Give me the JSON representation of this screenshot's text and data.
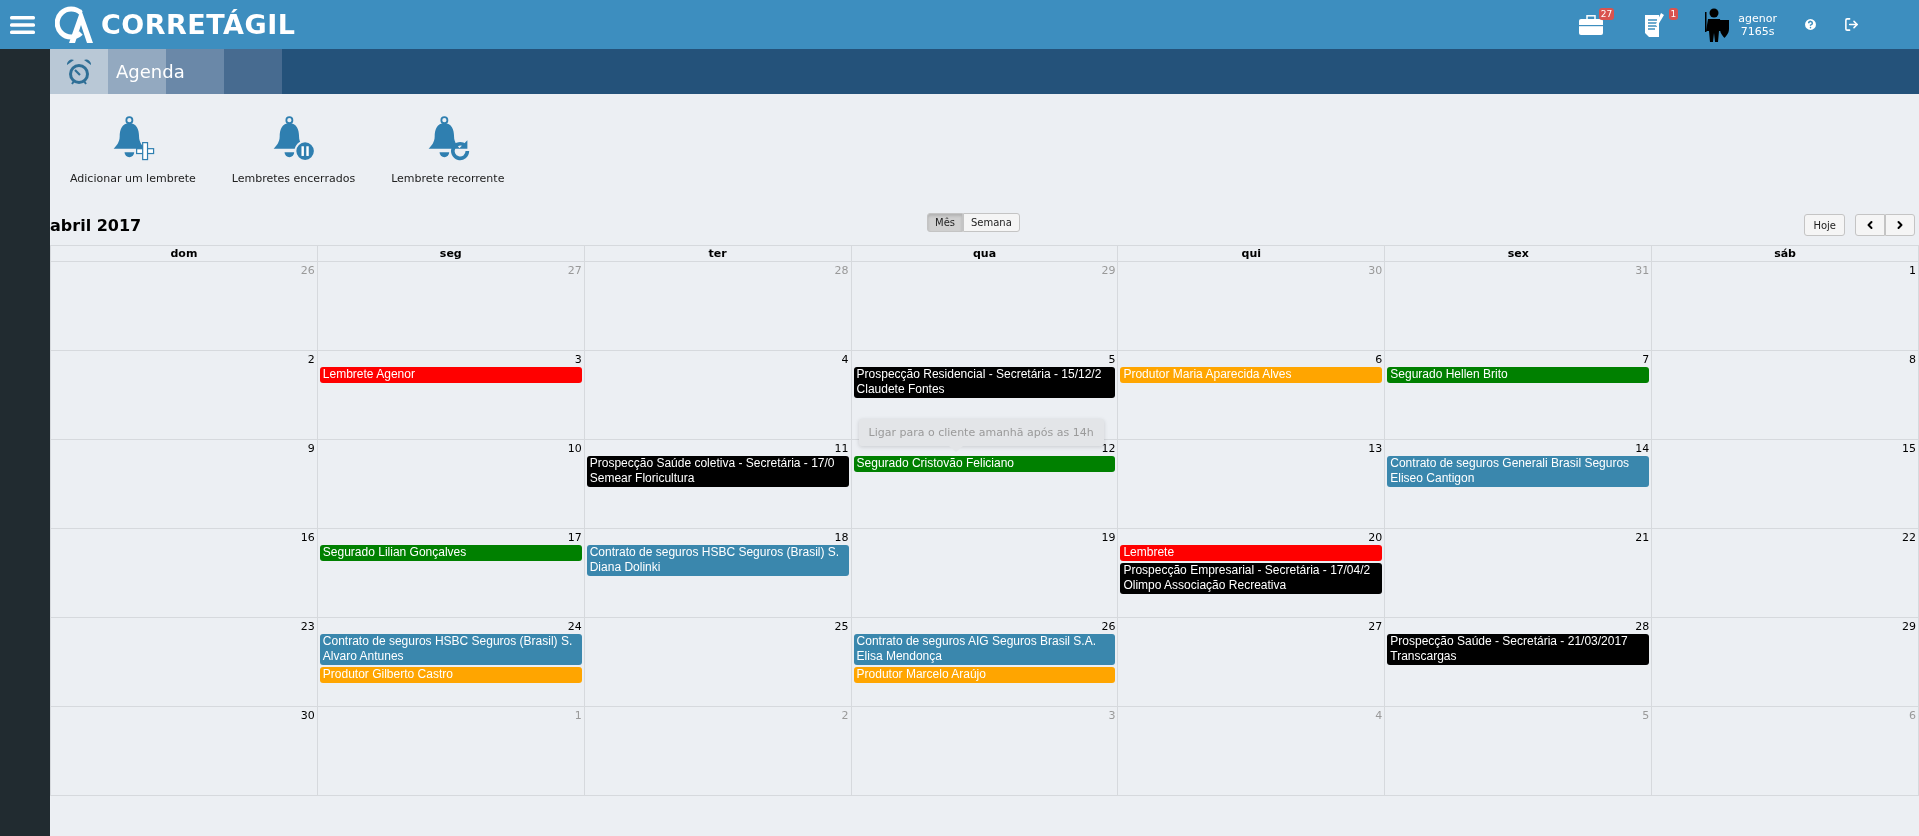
{
  "topbar": {
    "brand": "CORRETÁGIL",
    "notifications": [
      {
        "kind": "briefcase",
        "count": "27"
      },
      {
        "kind": "document",
        "count": "1"
      }
    ],
    "user": {
      "name": "agenor",
      "points": "7165s"
    }
  },
  "nav": {
    "title": "Agenda"
  },
  "actions": [
    {
      "kind": "add",
      "label": "Adicionar um lembrete"
    },
    {
      "kind": "pause",
      "label": "Lembretes encerrados"
    },
    {
      "kind": "recurring",
      "label": "Lembrete recorrente"
    }
  ],
  "calendar": {
    "title": "abril 2017",
    "views": [
      {
        "label": "Mês",
        "selected": true
      },
      {
        "label": "Semana",
        "selected": false
      }
    ],
    "today": "Hoje",
    "weekdays": [
      "dom",
      "seg",
      "ter",
      "qua",
      "qui",
      "sex",
      "sáb"
    ],
    "weeks": [
      {
        "days": [
          {
            "number": "26",
            "other_month": true
          },
          {
            "number": "27",
            "other_month": true
          },
          {
            "number": "28",
            "other_month": true
          },
          {
            "number": "29",
            "other_month": true
          },
          {
            "number": "30",
            "other_month": true
          },
          {
            "number": "31",
            "other_month": true
          },
          {
            "number": "1",
            "other_month": false
          }
        ]
      },
      {
        "days": [
          {
            "number": "2",
            "other_month": false
          },
          {
            "number": "3",
            "other_month": false,
            "events": [
              {
                "lines": [
                  "Lembrete Agenor"
                ],
                "color": "#ff0000"
              }
            ]
          },
          {
            "number": "4",
            "other_month": false
          },
          {
            "number": "5",
            "other_month": false,
            "events": [
              {
                "lines": [
                  "Prospecção Residencial - Secretária - 15/12/2",
                  "Claudete Fontes"
                ],
                "color": "#000000"
              }
            ]
          },
          {
            "number": "6",
            "other_month": false,
            "events": [
              {
                "lines": [
                  "Produtor Maria Aparecida Alves"
                ],
                "color": "#ffa500"
              }
            ]
          },
          {
            "number": "7",
            "other_month": false,
            "events": [
              {
                "lines": [
                  "Segurado Hellen Brito"
                ],
                "color": "#008000"
              }
            ]
          },
          {
            "number": "8",
            "other_month": false
          }
        ]
      },
      {
        "days": [
          {
            "number": "9",
            "other_month": false
          },
          {
            "number": "10",
            "other_month": false
          },
          {
            "number": "11",
            "other_month": false,
            "events": [
              {
                "lines": [
                  "Prospecção Saúde coletiva - Secretária - 17/0",
                  "Semear Floricultura"
                ],
                "color": "#000000"
              }
            ]
          },
          {
            "number": "12",
            "other_month": false,
            "events": [
              {
                "lines": [
                  "Segurado Cristovão Feliciano"
                ],
                "color": "#008000",
                "tooltip": "Ligar para o cliente amanhã após as 14h"
              }
            ]
          },
          {
            "number": "13",
            "other_month": false
          },
          {
            "number": "14",
            "other_month": false,
            "events": [
              {
                "lines": [
                  "Contrato de seguros Generali Brasil Seguros",
                  "Eliseo Cantigon"
                ],
                "color": "#3a87ad"
              }
            ]
          },
          {
            "number": "15",
            "other_month": false
          }
        ]
      },
      {
        "days": [
          {
            "number": "16",
            "other_month": false
          },
          {
            "number": "17",
            "other_month": false,
            "events": [
              {
                "lines": [
                  "Segurado Lilian Gonçalves"
                ],
                "color": "#008000"
              }
            ]
          },
          {
            "number": "18",
            "other_month": false,
            "events": [
              {
                "lines": [
                  "Contrato de seguros HSBC Seguros (Brasil) S.",
                  "Diana Dolinki"
                ],
                "color": "#3a87ad"
              }
            ]
          },
          {
            "number": "19",
            "other_month": false
          },
          {
            "number": "20",
            "other_month": false,
            "events": [
              {
                "lines": [
                  "Lembrete"
                ],
                "color": "#ff0000"
              },
              {
                "lines": [
                  "Prospecção Empresarial - Secretária - 17/04/2",
                  "Olimpo Associação Recreativa"
                ],
                "color": "#000000"
              }
            ]
          },
          {
            "number": "21",
            "other_month": false
          },
          {
            "number": "22",
            "other_month": false
          }
        ]
      },
      {
        "days": [
          {
            "number": "23",
            "other_month": false
          },
          {
            "number": "24",
            "other_month": false,
            "events": [
              {
                "lines": [
                  "Contrato de seguros HSBC Seguros (Brasil) S.",
                  "Alvaro Antunes"
                ],
                "color": "#3a87ad"
              },
              {
                "lines": [
                  "Produtor Gilberto Castro"
                ],
                "color": "#ffa500"
              }
            ]
          },
          {
            "number": "25",
            "other_month": false
          },
          {
            "number": "26",
            "other_month": false,
            "events": [
              {
                "lines": [
                  "Contrato de seguros AIG Seguros Brasil S.A.",
                  "Elisa Mendonça"
                ],
                "color": "#3a87ad"
              },
              {
                "lines": [
                  "Produtor Marcelo Araújo"
                ],
                "color": "#ffa500"
              }
            ]
          },
          {
            "number": "27",
            "other_month": false
          },
          {
            "number": "28",
            "other_month": false,
            "events": [
              {
                "lines": [
                  "Prospecção Saúde - Secretária - 21/03/2017",
                  "Transcargas"
                ],
                "color": "#000000"
              }
            ]
          },
          {
            "number": "29",
            "other_month": false
          }
        ]
      },
      {
        "days": [
          {
            "number": "30",
            "other_month": false
          },
          {
            "number": "1",
            "other_month": true
          },
          {
            "number": "2",
            "other_month": true
          },
          {
            "number": "3",
            "other_month": true
          },
          {
            "number": "4",
            "other_month": true
          },
          {
            "number": "5",
            "other_month": true
          },
          {
            "number": "6",
            "other_month": true
          }
        ]
      }
    ]
  }
}
